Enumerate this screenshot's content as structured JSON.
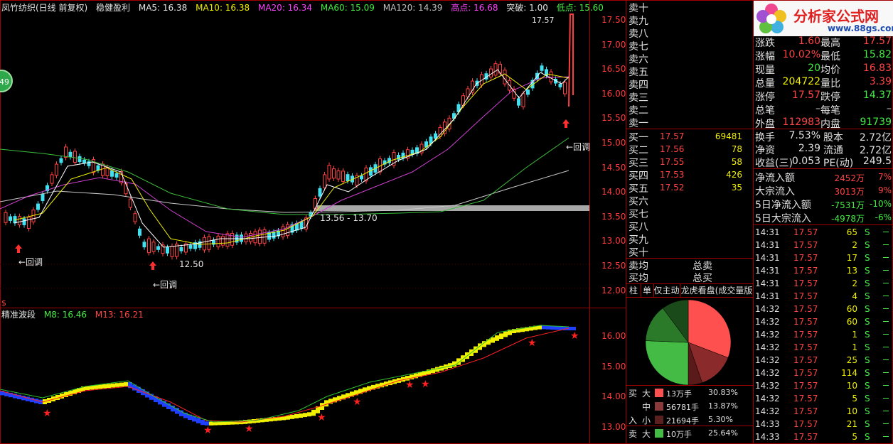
{
  "header": {
    "title": "凤竹纺织(日线 前复权)",
    "indicator": "稳健盈利",
    "ma5": "MA5: 16.38",
    "ma10": "MA10: 16.38",
    "ma20": "MA20: 16.34",
    "ma60": "MA60: 15.09",
    "ma120": "MA120: 14.39",
    "high": "高点: 16.68",
    "breakout": "突破: 1.00",
    "low": "低点: 15.60"
  },
  "badge": "49",
  "chart_annotations": {
    "peak": "17.57",
    "range": "13.56 - 13.70",
    "low": "12.50",
    "pullback": "←回调",
    "pullback_right": "←回调"
  },
  "price_axis": [
    "17.50",
    "17.00",
    "16.50",
    "16.00",
    "15.50",
    "15.00",
    "14.50",
    "14.00",
    "13.50",
    "13.00",
    "12.50",
    "12.00"
  ],
  "sub_header": {
    "title": "精准波段",
    "m8": "M8: 16.46",
    "m13": "M13: 16.21",
    "dollar": "$"
  },
  "sub_axis": [
    "16.00",
    "15.00",
    "14.00",
    "13.00"
  ],
  "sell_levels": [
    "卖十",
    "卖九",
    "卖八",
    "卖七",
    "卖六",
    "卖五",
    "卖四",
    "卖三",
    "卖二",
    "卖一"
  ],
  "buy_levels": [
    {
      "name": "买一",
      "price": "17.57",
      "vol": "69481"
    },
    {
      "name": "买二",
      "price": "17.56",
      "vol": "78"
    },
    {
      "name": "买三",
      "price": "17.55",
      "vol": "58"
    },
    {
      "name": "买四",
      "price": "17.53",
      "vol": "426"
    },
    {
      "name": "买五",
      "price": "17.52",
      "vol": "35"
    },
    {
      "name": "买六",
      "price": "",
      "vol": ""
    },
    {
      "name": "买七",
      "price": "",
      "vol": ""
    },
    {
      "name": "买八",
      "price": "",
      "vol": ""
    },
    {
      "name": "买九",
      "price": "",
      "vol": ""
    },
    {
      "name": "买十",
      "price": "",
      "vol": ""
    }
  ],
  "avg": {
    "sell_label": "卖均",
    "sell_total": "总卖",
    "buy_label": "买均",
    "buy_total": "总买"
  },
  "tabs": [
    "柱",
    "单",
    "仅主动",
    "龙虎看盘(成交量版"
  ],
  "pie": {
    "slices": [
      30.83,
      13.87,
      5.3,
      25.64,
      14.21,
      10.15
    ],
    "colors": [
      "#ff5050",
      "#8a2a2a",
      "#5a1a1a",
      "#44bb44",
      "#2a7a2a",
      "#1a4a1a"
    ]
  },
  "flow_legend": [
    {
      "side": "买",
      "size": "大",
      "color": "#ff5050",
      "vol": "13万手",
      "pct": "30.83%"
    },
    {
      "side": "",
      "size": "中",
      "color": "#8a3a3a",
      "vol": "56781手",
      "pct": "13.87%"
    },
    {
      "side": "入",
      "size": "小",
      "color": "#5a2020",
      "vol": "21694手",
      "pct": "5.30%"
    },
    {
      "side": "卖",
      "size": "大",
      "color": "#44bb44",
      "vol": "10万手",
      "pct": "25.64%"
    }
  ],
  "logo": {
    "title": "分析家公式网",
    "url": "www.88gs.com"
  },
  "quote": {
    "rows": [
      {
        "l1": "涨跌",
        "v1": "1.60",
        "l2": "最高",
        "v2": "17.57",
        "c1": "#ff4444",
        "c2": "#ff4444"
      },
      {
        "l1": "涨幅",
        "v1": "10.02%",
        "l2": "最低",
        "v2": "15.82",
        "c1": "#ff4444",
        "c2": "#44ee44"
      },
      {
        "l1": "现量",
        "v1": "20",
        "l2": "均价",
        "v2": "16.83",
        "c1": "#44ee44",
        "c2": "#ff4444"
      },
      {
        "l1": "总量",
        "v1": "204722",
        "l2": "量比",
        "v2": "3.39",
        "c1": "#f0f000",
        "c2": "#ff4444"
      },
      {
        "l1": "涨停",
        "v1": "17.57",
        "l2": "跌停",
        "v2": "14.37",
        "c1": "#ff4444",
        "c2": "#44ee44"
      },
      {
        "l1": "总笔",
        "v1": "–",
        "l2": "每笔",
        "v2": "–",
        "c1": "#c0c0c0",
        "c2": "#c0c0c0"
      },
      {
        "l1": "外盘",
        "v1": "112983",
        "l2": "内盘",
        "v2": "91739",
        "c1": "#ff4444",
        "c2": "#44ee44"
      }
    ],
    "rows2": [
      {
        "l1": "换手",
        "v1": "7.53%",
        "l2": "股本",
        "v2": "2.72亿"
      },
      {
        "l1": "净资",
        "v1": "2.39",
        "l2": "流通",
        "v2": "2.72亿"
      },
      {
        "l1": "收益(三)",
        "v1": "0.053",
        "l2": "PE(动)",
        "v2": "249.5"
      }
    ],
    "flows": [
      {
        "label": "净流入额",
        "val": "2452万",
        "pct": "7%",
        "color": "#ff4444"
      },
      {
        "label": "大宗流入",
        "val": "3013万",
        "pct": "9%",
        "color": "#ff4444"
      },
      {
        "label": "5日净流入额",
        "val": "-7531万",
        "pct": "-10%",
        "color": "#44ee44"
      },
      {
        "label": "5日大宗流入",
        "val": "-4978万",
        "pct": "-6%",
        "color": "#44ee44"
      }
    ]
  },
  "ticks": [
    {
      "t": "14:31",
      "p": "17.57",
      "v": "65",
      "s": "S"
    },
    {
      "t": "14:31",
      "p": "17.57",
      "v": "2",
      "s": "S"
    },
    {
      "t": "14:31",
      "p": "17.57",
      "v": "17",
      "s": "S"
    },
    {
      "t": "14:31",
      "p": "17.57",
      "v": "13",
      "s": "S"
    },
    {
      "t": "14:31",
      "p": "17.57",
      "v": "2",
      "s": "S"
    },
    {
      "t": "14:31",
      "p": "17.57",
      "v": "4",
      "s": "S"
    },
    {
      "t": "14:32",
      "p": "17.57",
      "v": "60",
      "s": "S"
    },
    {
      "t": "14:32",
      "p": "17.57",
      "v": "60",
      "s": "S"
    },
    {
      "t": "14:32",
      "p": "17.57",
      "v": "1",
      "s": "S"
    },
    {
      "t": "14:32",
      "p": "17.57",
      "v": "1",
      "s": "S"
    },
    {
      "t": "14:32",
      "p": "17.57",
      "v": "25",
      "s": "S"
    },
    {
      "t": "14:32",
      "p": "17.57",
      "v": "114",
      "s": "S"
    },
    {
      "t": "14:32",
      "p": "17.57",
      "v": "10",
      "s": "S"
    },
    {
      "t": "14:32",
      "p": "17.57",
      "v": "5",
      "s": "S"
    },
    {
      "t": "14:32",
      "p": "17.57",
      "v": "10",
      "s": "S"
    },
    {
      "t": "14:33",
      "p": "17.57",
      "v": "21",
      "s": "S"
    },
    {
      "t": "14:33",
      "p": "17.57",
      "v": "5",
      "s": "S"
    }
  ]
}
